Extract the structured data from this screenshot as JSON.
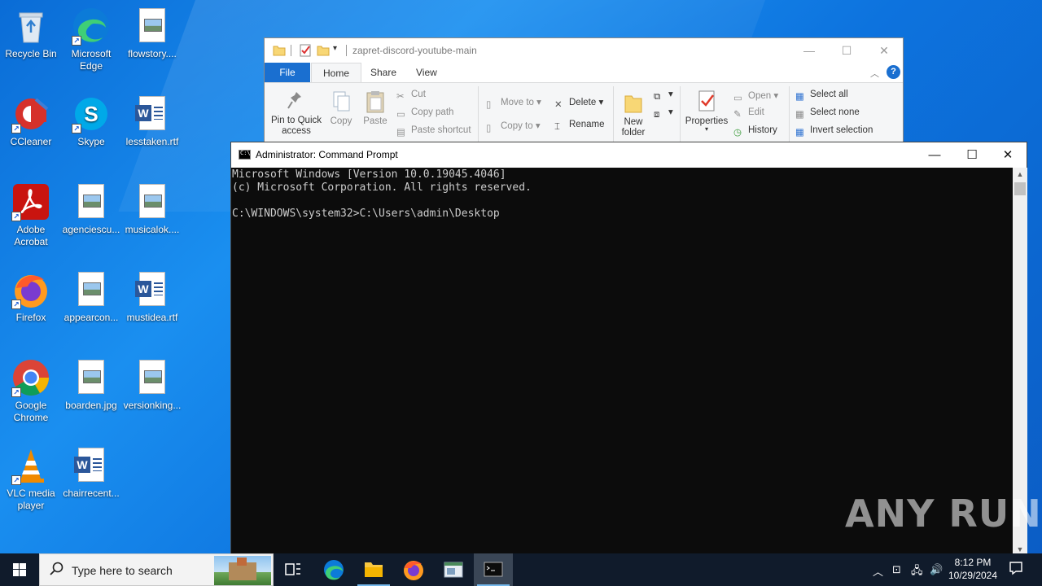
{
  "desktop": {
    "icons": [
      {
        "label": "Recycle Bin"
      },
      {
        "label": "Microsoft Edge"
      },
      {
        "label": "flowstory...."
      },
      {
        "label": "CCleaner"
      },
      {
        "label": "Skype"
      },
      {
        "label": "lesstaken.rtf"
      },
      {
        "label": "Adobe Acrobat"
      },
      {
        "label": "agenciescu..."
      },
      {
        "label": "musicalok...."
      },
      {
        "label": "Firefox"
      },
      {
        "label": "appearcon..."
      },
      {
        "label": "mustidea.rtf"
      },
      {
        "label": "Google Chrome"
      },
      {
        "label": "boarden.jpg"
      },
      {
        "label": "versionking..."
      },
      {
        "label": "VLC media player"
      },
      {
        "label": "chairrecent..."
      }
    ]
  },
  "explorer": {
    "title": "zapret-discord-youtube-main",
    "tabs": {
      "file": "File",
      "home": "Home",
      "share": "Share",
      "view": "View"
    },
    "ribbon": {
      "pin": "Pin to Quick access",
      "copy": "Copy",
      "paste": "Paste",
      "cut": "Cut",
      "copy_path": "Copy path",
      "paste_shortcut": "Paste shortcut",
      "move_to": "Move to",
      "copy_to": "Copy to",
      "delete": "Delete",
      "rename": "Rename",
      "new_folder": "New folder",
      "properties": "Properties",
      "open": "Open",
      "edit": "Edit",
      "history": "History",
      "select_all": "Select all",
      "select_none": "Select none",
      "invert_selection": "Invert selection"
    }
  },
  "cmd": {
    "title": "Administrator: Command Prompt",
    "lines": [
      "Microsoft Windows [Version 10.0.19045.4046]",
      "(c) Microsoft Corporation. All rights reserved.",
      "",
      "C:\\WINDOWS\\system32>C:\\Users\\admin\\Desktop"
    ]
  },
  "watermark": "ANY RUN",
  "taskbar": {
    "search_placeholder": "Type here to search",
    "time": "8:12 PM",
    "date": "10/29/2024"
  }
}
